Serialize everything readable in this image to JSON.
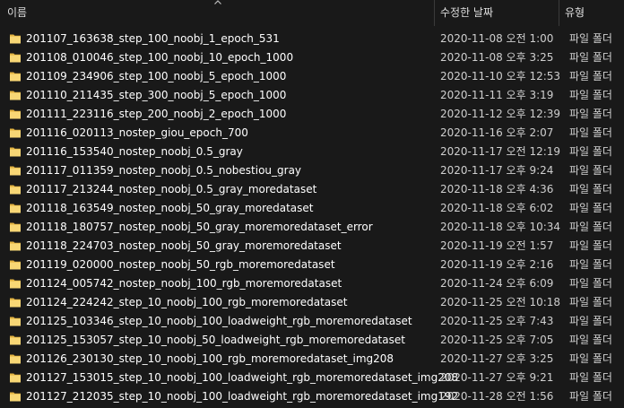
{
  "header": {
    "name_label": "이름",
    "date_label": "수정한 날짜",
    "type_label": "유형"
  },
  "rows": [
    {
      "name": "201107_163638_step_100_noobj_1_epoch_531",
      "date": "2020-11-08 오전 1:00",
      "type": "파일 폴더"
    },
    {
      "name": "201108_010046_step_100_noobj_10_epoch_1000",
      "date": "2020-11-08 오후 3:25",
      "type": "파일 폴더"
    },
    {
      "name": "201109_234906_step_100_noobj_5_epoch_1000",
      "date": "2020-11-10 오후 12:53",
      "type": "파일 폴더"
    },
    {
      "name": "201110_211435_step_300_noobj_5_epoch_1000",
      "date": "2020-11-11 오후 3:19",
      "type": "파일 폴더"
    },
    {
      "name": "201111_223116_step_200_noobj_2_epoch_1000",
      "date": "2020-11-12 오후 12:39",
      "type": "파일 폴더"
    },
    {
      "name": "201116_020113_nostep_giou_epoch_700",
      "date": "2020-11-16 오후 2:07",
      "type": "파일 폴더"
    },
    {
      "name": "201116_153540_nostep_noobj_0.5_gray",
      "date": "2020-11-17 오전 12:19",
      "type": "파일 폴더"
    },
    {
      "name": "201117_011359_nostep_noobj_0.5_nobestiou_gray",
      "date": "2020-11-17 오후 9:24",
      "type": "파일 폴더"
    },
    {
      "name": "201117_213244_nostep_noobj_0.5_gray_moredataset",
      "date": "2020-11-18 오후 4:36",
      "type": "파일 폴더"
    },
    {
      "name": "201118_163549_nostep_noobj_50_gray_moredataset",
      "date": "2020-11-18 오후 6:02",
      "type": "파일 폴더"
    },
    {
      "name": "201118_180757_nostep_noobj_50_gray_moremoredataset_error",
      "date": "2020-11-18 오후 10:34",
      "type": "파일 폴더"
    },
    {
      "name": "201118_224703_nostep_noobj_50_gray_moremoredataset",
      "date": "2020-11-19 오전 1:57",
      "type": "파일 폴더"
    },
    {
      "name": "201119_020000_nostep_noobj_50_rgb_moremoredataset",
      "date": "2020-11-19 오후 2:16",
      "type": "파일 폴더"
    },
    {
      "name": "201124_005742_nostep_noobj_100_rgb_moremoredataset",
      "date": "2020-11-24 오후 6:09",
      "type": "파일 폴더"
    },
    {
      "name": "201124_224242_step_10_noobj_100_rgb_moremoredataset",
      "date": "2020-11-25 오전 10:18",
      "type": "파일 폴더"
    },
    {
      "name": "201125_103346_step_10_noobj_100_loadweight_rgb_moremoredataset",
      "date": "2020-11-25 오후 7:43",
      "type": "파일 폴더"
    },
    {
      "name": "201125_153057_step_10_noobj_50_loadweight_rgb_moremoredataset",
      "date": "2020-11-25 오후 7:05",
      "type": "파일 폴더"
    },
    {
      "name": "201126_230130_step_10_noobj_100_rgb_moremoredataset_img208",
      "date": "2020-11-27 오후 3:25",
      "type": "파일 폴더"
    },
    {
      "name": "201127_153015_step_10_noobj_100_loadweight_rgb_moremoredataset_img208",
      "date": "2020-11-27 오후 9:21",
      "type": "파일 폴더"
    },
    {
      "name": "201127_212035_step_10_noobj_100_loadweight_rgb_moremoredataset_img192",
      "date": "2020-11-28 오전 1:56",
      "type": "파일 폴더"
    }
  ],
  "icons": {
    "folder": "folder-icon",
    "sort": "sort-up-arrow-icon"
  },
  "colors": {
    "background": "#191919",
    "folder_yellow": "#f8d775",
    "folder_dark": "#e3b341",
    "text": "#ffffff",
    "secondary_text": "#cfcfcf"
  }
}
